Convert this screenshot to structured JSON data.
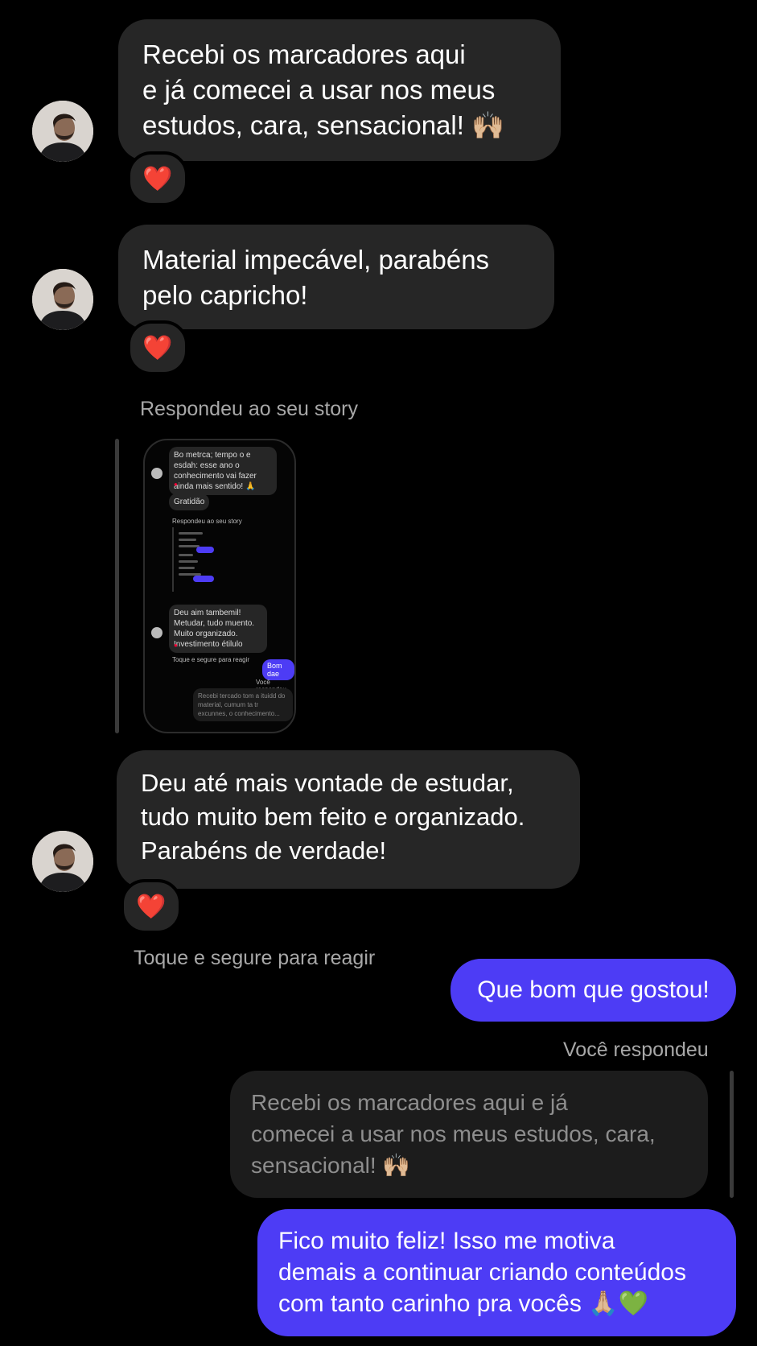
{
  "messages": {
    "m1": {
      "lines": [
        "Recebi os marcadores aqui",
        "e já comecei a usar nos meus",
        "estudos, cara, sensacional! 🙌🏼"
      ],
      "reaction": "❤️"
    },
    "m2": {
      "lines": [
        "Material impecável, parabéns",
        "pelo capricho!"
      ],
      "reaction": "❤️"
    },
    "story_label": "Respondeu ao seu story",
    "story_preview": {
      "msg1": "Bo metrca; tempo o e esdah: esse ano o conhecimento vai fazer ainda mais sentido! 🙏",
      "msg2": "Gratidão",
      "label": "Respondeu ao seu story",
      "msg3": "Deu aim tambemil! Metudar, tudo muento. Muito organizado. Investimento étilulo",
      "hint": "Toque e segure para reagir",
      "out": "Bom dae",
      "you": "Você respondeu",
      "quoted": "Recebi tercado tom a ituidd do material, cumum ta tr excunnes, o conhecimento..."
    },
    "m3": {
      "lines": [
        "Deu até mais vontade de estudar,",
        "tudo muito bem feito e organizado.",
        "Parabéns de verdade!"
      ],
      "reaction": "❤️"
    },
    "hint": "Toque e segure para reagir",
    "out1": "Que bom que gostou!",
    "you_replied": "Você respondeu",
    "quoted": {
      "lines": [
        "Recebi os marcadores aqui e já",
        "comecei a usar nos meus estudos, cara,",
        "sensacional! 🙌🏼"
      ]
    },
    "out2": {
      "lines": [
        "Fico muito feliz! Isso me motiva",
        "demais a continuar criando conteúdos",
        "com tanto carinho pra vocês 🙏🏼💚"
      ]
    }
  },
  "colors": {
    "background": "#000000",
    "incoming_bubble": "#262626",
    "outgoing_bubble": "#4d3cf5",
    "secondary_text": "#a8a8a8"
  },
  "icons": [
    "avatar",
    "heart-reaction-icon"
  ]
}
